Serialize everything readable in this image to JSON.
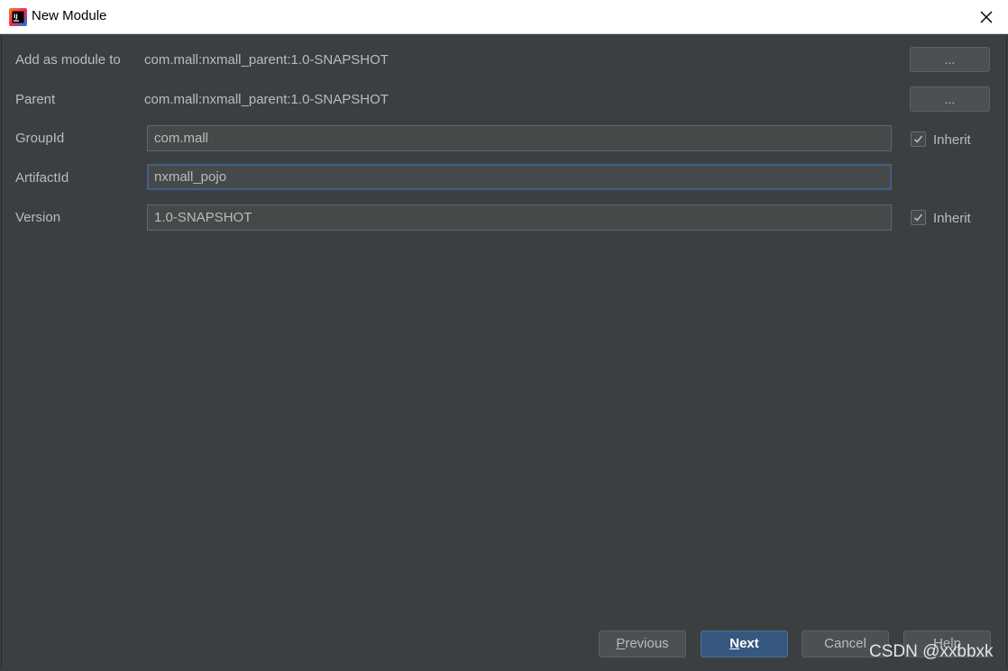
{
  "window": {
    "title": "New Module",
    "icon": "intellij-idea-icon"
  },
  "form": {
    "add_as_module_to": {
      "label": "Add as module to",
      "value": "com.mall:nxmall_parent:1.0-SNAPSHOT",
      "button": "..."
    },
    "parent": {
      "label": "Parent",
      "value": "com.mall:nxmall_parent:1.0-SNAPSHOT",
      "button": "..."
    },
    "group_id": {
      "label": "GroupId",
      "value": "com.mall",
      "inherit_label": "Inherit",
      "inherit_checked": true
    },
    "artifact_id": {
      "label": "ArtifactId",
      "value": "nxmall_pojo"
    },
    "version": {
      "label": "Version",
      "value": "1.0-SNAPSHOT",
      "inherit_label": "Inherit",
      "inherit_checked": true
    }
  },
  "footer": {
    "previous": "Previous",
    "next": "Next",
    "cancel": "Cancel",
    "help": "Help"
  },
  "watermark": "CSDN @xxbbxk",
  "colors": {
    "background": "#3c3f41",
    "primary_button": "#365880",
    "focus_border": "#3d6185"
  }
}
